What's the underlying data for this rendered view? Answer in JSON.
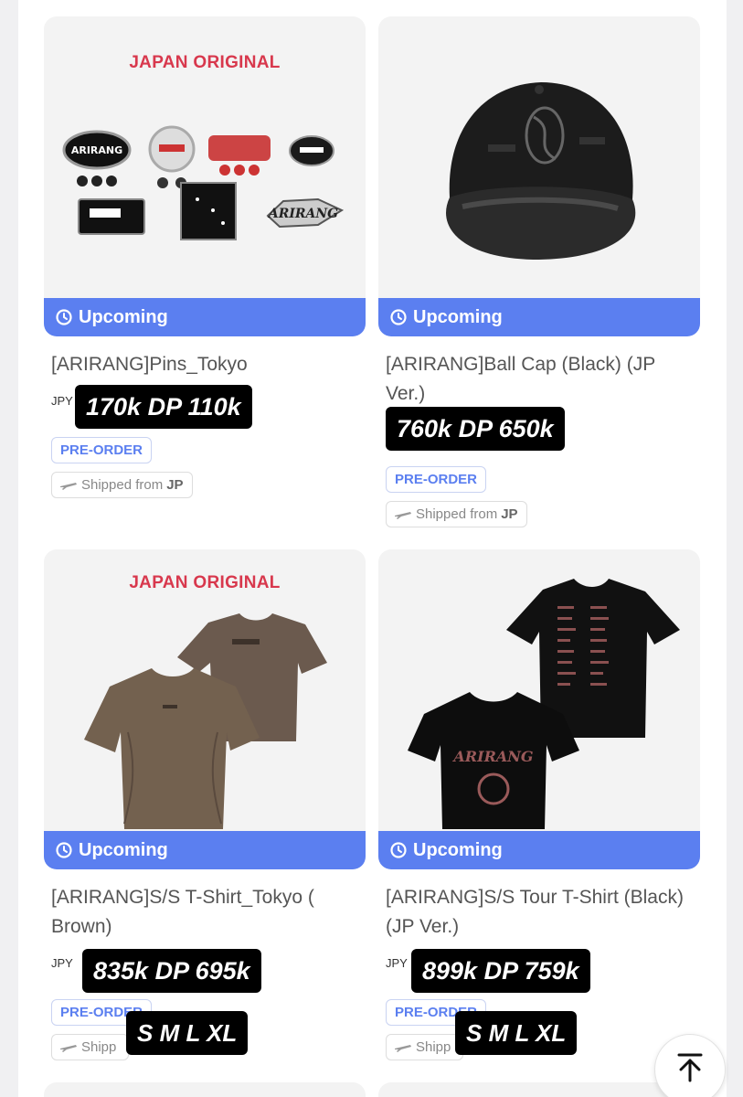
{
  "products": [
    {
      "overlay": "JAPAN ORIGINAL",
      "status": "Upcoming",
      "title": "[ARIRANG]Pins_Tokyo",
      "currency": "JPY",
      "price_sticker": "170k DP 110k",
      "badge": "PRE-ORDER",
      "ship_prefix": "Shipped from",
      "ship_country": "JP"
    },
    {
      "overlay": "",
      "status": "Upcoming",
      "title": "[ARIRANG]Ball Cap (Black) (JP Ver.)",
      "currency": "",
      "price_sticker": "760k DP 650k",
      "badge": "PRE-ORDER",
      "ship_prefix": "Shipped from",
      "ship_country": "JP"
    },
    {
      "overlay": "JAPAN ORIGINAL",
      "status": "Upcoming",
      "title": "[ARIRANG]S/S T-Shirt_Tokyo ( Brown)",
      "currency": "JPY",
      "price_sticker": "835k DP 695k",
      "badge": "PRE-ORDER",
      "ship_prefix": "Shipp",
      "ship_country": "",
      "sizes_sticker": "S M L XL"
    },
    {
      "overlay": "",
      "status": "Upcoming",
      "title": "[ARIRANG]S/S Tour T-Shirt (Black) (JP Ver.)",
      "currency": "JPY",
      "price_sticker": "899k DP 759k",
      "badge": "PRE-ORDER",
      "ship_prefix": "Shipp",
      "ship_country": "",
      "sizes_sticker": "S M L XL"
    }
  ],
  "scroll_top_icon": "arrow-up-to-top-icon",
  "colors": {
    "accent": "#5b7ff0",
    "overlay_red": "#d8384d",
    "sticker": "#000000"
  }
}
